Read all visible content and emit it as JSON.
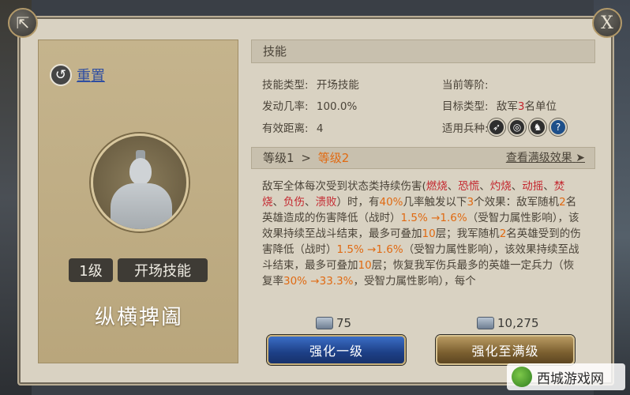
{
  "header": {
    "share_icon": "share-icon",
    "close_icon": "close-icon",
    "close_label": "X"
  },
  "left": {
    "reset_label": "重置",
    "level_tag": "1级",
    "skill_type_tag": "开场技能",
    "skill_name": "纵横捭阖"
  },
  "right": {
    "section_title": "技能",
    "info": {
      "skill_type_key": "技能类型:",
      "skill_type_val": "开场技能",
      "current_level_key": "当前等阶:",
      "trigger_rate_key": "发动几率:",
      "trigger_rate_val": "100.0%",
      "target_type_key": "目标类型:",
      "target_type_pre": "敌军",
      "target_type_num": "3",
      "target_type_post": "名单位",
      "range_key": "有效距离:",
      "range_val": "4",
      "units_key": "适用兵种:"
    },
    "unit_icons": [
      "bow-icon",
      "shield-icon",
      "horse-icon",
      "question-icon"
    ],
    "level_bar": {
      "level1": "等级1",
      "arrow": ">",
      "level2": "等级2",
      "view_max": "查看满级效果",
      "view_max_arrow": "➤"
    },
    "description": [
      {
        "t": "敌军全体每次受到状态类持续伤害(",
        "c": ""
      },
      {
        "t": "燃烧",
        "c": "red"
      },
      {
        "t": "、",
        "c": ""
      },
      {
        "t": "恐慌",
        "c": "red"
      },
      {
        "t": "、",
        "c": ""
      },
      {
        "t": "灼烧",
        "c": "red"
      },
      {
        "t": "、",
        "c": ""
      },
      {
        "t": "动摇",
        "c": "red"
      },
      {
        "t": "、",
        "c": ""
      },
      {
        "t": "焚烧",
        "c": "red"
      },
      {
        "t": "、",
        "c": ""
      },
      {
        "t": "负伤",
        "c": "red"
      },
      {
        "t": "、",
        "c": ""
      },
      {
        "t": "溃败",
        "c": "red"
      },
      {
        "t": "）时，有",
        "c": ""
      },
      {
        "t": "40%",
        "c": "orange"
      },
      {
        "t": "几率触发以下",
        "c": ""
      },
      {
        "t": "3",
        "c": "orange"
      },
      {
        "t": "个效果：敌军随机",
        "c": ""
      },
      {
        "t": "2",
        "c": "orange"
      },
      {
        "t": "名英雄造成的伤害降低（战时）",
        "c": ""
      },
      {
        "t": "1.5% →1.6%",
        "c": "orange"
      },
      {
        "t": "（受智力属性影响），该效果持续至战斗结束，最多可叠加",
        "c": ""
      },
      {
        "t": "10",
        "c": "orange"
      },
      {
        "t": "层；我军随机",
        "c": ""
      },
      {
        "t": "2",
        "c": "orange"
      },
      {
        "t": "名英雄受到的伤害降低（战时）",
        "c": ""
      },
      {
        "t": "1.5% →1.6%",
        "c": "orange"
      },
      {
        "t": "（受智力属性影响），该效果持续至战斗结束，最多可叠加",
        "c": ""
      },
      {
        "t": "10",
        "c": "orange"
      },
      {
        "t": "层；恢复我军伤兵最多的英雄一定兵力（恢复率",
        "c": ""
      },
      {
        "t": "30% →33.3%",
        "c": "orange"
      },
      {
        "t": "，受智力属性影响），每个",
        "c": ""
      }
    ]
  },
  "actions": {
    "cost_1": "75",
    "cost_2": "10,275",
    "upgrade_one_label": "强化一级",
    "upgrade_max_label": "强化至满级"
  },
  "watermark": {
    "text": "西城游戏网"
  }
}
